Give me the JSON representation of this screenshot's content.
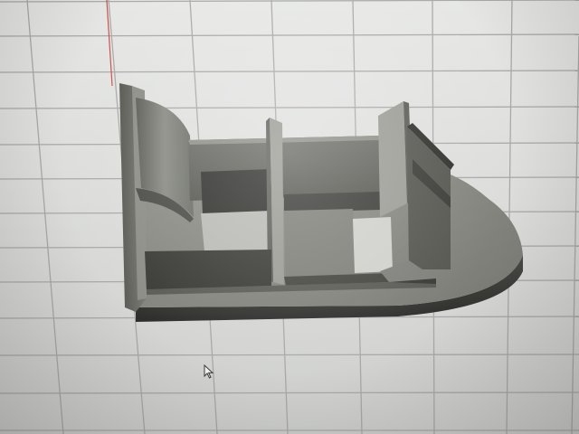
{
  "scene": {
    "name": "3d-model-viewport",
    "background_color": "#dcdddb",
    "grid_color": "#a9aaa8",
    "model_color_light": "#8a8b84",
    "model_color_mid": "#6e6f69",
    "model_color_dark": "#3f403c",
    "icons": [
      "cursor-arrow-icon"
    ]
  }
}
